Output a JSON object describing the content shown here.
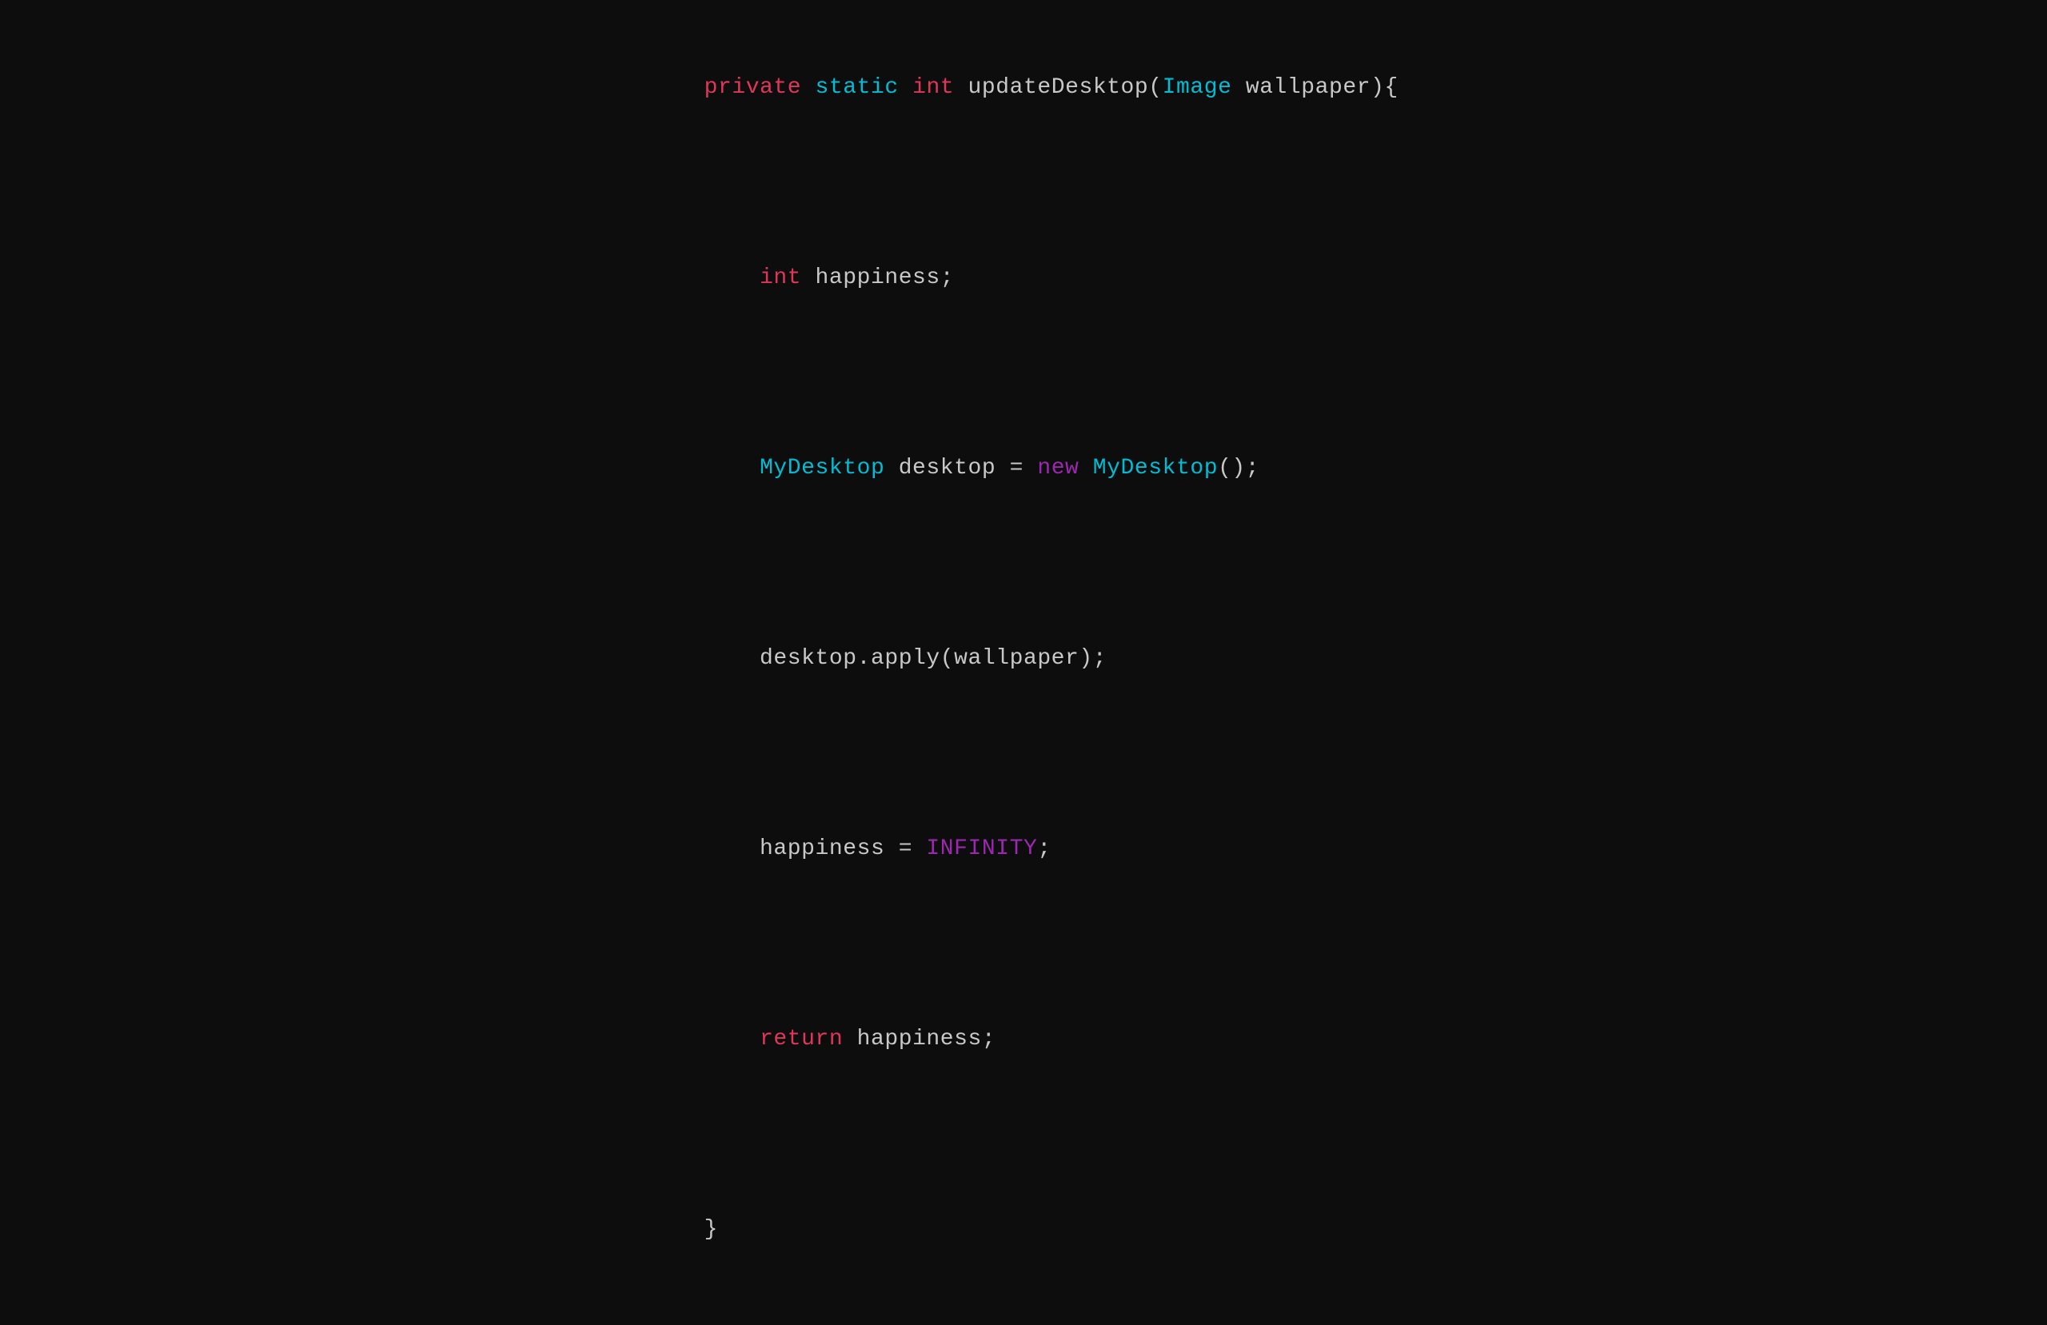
{
  "code": {
    "line1": {
      "parts": [
        {
          "text": "private",
          "class": "keyword-private"
        },
        {
          "text": " ",
          "class": "plain"
        },
        {
          "text": "static",
          "class": "keyword-static"
        },
        {
          "text": " ",
          "class": "plain"
        },
        {
          "text": "int",
          "class": "keyword-int"
        },
        {
          "text": " updateDesktop(",
          "class": "plain"
        },
        {
          "text": "Image",
          "class": "type-image"
        },
        {
          "text": " wallpaper){",
          "class": "plain"
        }
      ]
    },
    "line2": {
      "parts": [
        {
          "text": "    ",
          "class": "plain"
        },
        {
          "text": "int",
          "class": "keyword-int"
        },
        {
          "text": " happiness;",
          "class": "plain"
        }
      ]
    },
    "line3": {
      "parts": [
        {
          "text": "    ",
          "class": "plain"
        },
        {
          "text": "MyDesktop",
          "class": "type-mydesktop"
        },
        {
          "text": " desktop = ",
          "class": "plain"
        },
        {
          "text": "new",
          "class": "keyword-new"
        },
        {
          "text": " ",
          "class": "plain"
        },
        {
          "text": "MyDesktop",
          "class": "type-mydesktop"
        },
        {
          "text": "();",
          "class": "plain"
        }
      ]
    },
    "line4": {
      "parts": [
        {
          "text": "    desktop.apply(wallpaper);",
          "class": "plain"
        }
      ]
    },
    "line5": {
      "parts": [
        {
          "text": "    happiness = ",
          "class": "plain"
        },
        {
          "text": "INFINITY",
          "class": "const-infinity"
        },
        {
          "text": ";",
          "class": "plain"
        }
      ]
    },
    "line6": {
      "parts": [
        {
          "text": "    ",
          "class": "plain"
        },
        {
          "text": "return",
          "class": "keyword-return"
        },
        {
          "text": " happiness;",
          "class": "plain"
        }
      ]
    },
    "line7": {
      "parts": [
        {
          "text": "}",
          "class": "brace"
        }
      ]
    }
  }
}
